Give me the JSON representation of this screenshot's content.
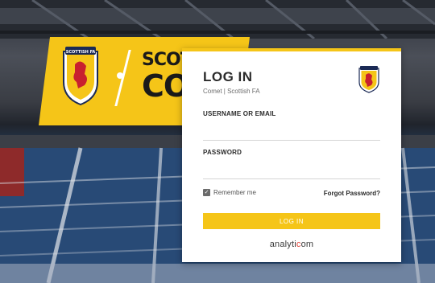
{
  "background": {
    "banner_line1": "SCOTTIS",
    "banner_line2": "COM",
    "crest_text": "SCOTTISH FA"
  },
  "login": {
    "title": "LOG IN",
    "subtitle": "Comet | Scottish FA",
    "username_label": "USERNAME OR EMAIL",
    "username_value": "",
    "password_label": "PASSWORD",
    "password_value": "",
    "remember_label": "Remember me",
    "remember_checked": true,
    "forgot_label": "Forgot Password?",
    "submit_label": "LOG IN",
    "brand_prefix": "analyti",
    "brand_mark": "c",
    "brand_suffix": "om"
  },
  "colors": {
    "accent": "#f5c518",
    "brand_mark": "#e03c31"
  }
}
